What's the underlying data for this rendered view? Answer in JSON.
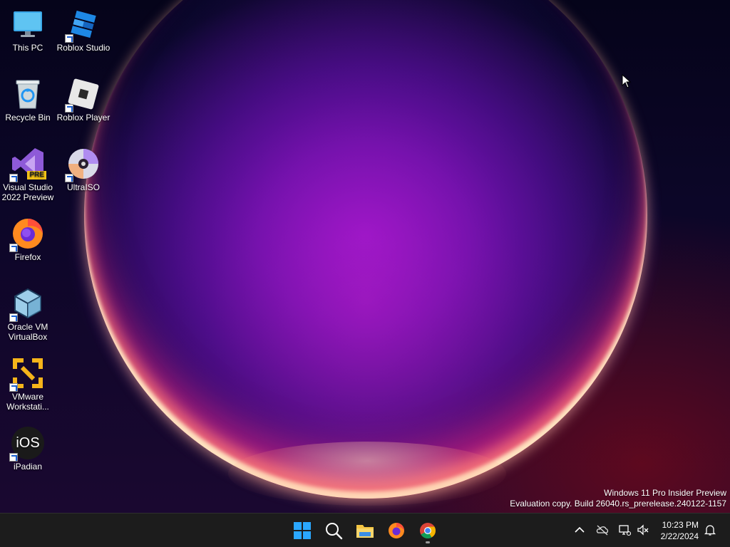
{
  "desktop": {
    "icons": [
      {
        "name": "This PC",
        "icon": "monitor-icon"
      },
      {
        "name": "Roblox Studio",
        "icon": "roblox-studio-icon"
      },
      {
        "name": "Recycle Bin",
        "icon": "recycle-bin-icon"
      },
      {
        "name": "Roblox Player",
        "icon": "roblox-player-icon"
      },
      {
        "name": "Visual Studio 2022 Preview",
        "icon": "visual-studio-icon",
        "badge": "PRE"
      },
      {
        "name": "UltraISO",
        "icon": "disc-icon"
      },
      {
        "name": "Firefox",
        "icon": "firefox-icon"
      },
      {
        "name": "Oracle VM VirtualBox",
        "icon": "virtualbox-icon"
      },
      {
        "name": "VMware Workstati...",
        "icon": "vmware-icon"
      },
      {
        "name": "iPadian",
        "icon": "ios-icon",
        "glyph": "iOS"
      }
    ]
  },
  "watermark": {
    "line1": "Windows 11 Pro Insider Preview",
    "line2": "Evaluation copy. Build 26040.rs_prerelease.240122-1157"
  },
  "taskbar": {
    "apps": [
      {
        "name": "Start",
        "icon": "windows-start-icon"
      },
      {
        "name": "Search",
        "icon": "search-icon"
      },
      {
        "name": "File Explorer",
        "icon": "folder-icon"
      },
      {
        "name": "Firefox",
        "icon": "firefox-icon"
      },
      {
        "name": "Google Chrome",
        "icon": "chrome-icon"
      }
    ],
    "tray": {
      "icons": [
        "chevron-up-icon",
        "onedrive-icon",
        "network-icon",
        "volume-muted-icon",
        "notification-bell-icon"
      ],
      "time": "10:23 PM",
      "date": "2/22/2024"
    }
  },
  "colors": {
    "taskbar_bg": "#1c1c1c",
    "start_blue": "#2aa7ff",
    "folder_yellow": "#f4c542"
  }
}
